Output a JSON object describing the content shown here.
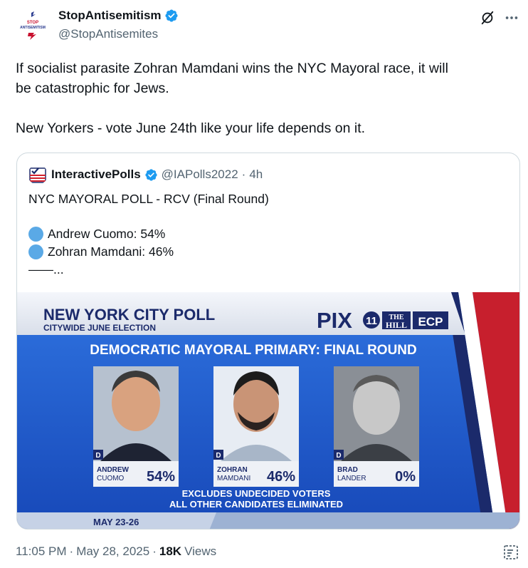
{
  "author": {
    "display_name": "StopAntisemitism",
    "handle": "@StopAntisemites",
    "logo_text_top": "STOP",
    "logo_text_bottom": "ANTISEMITISM"
  },
  "tweet": {
    "line1": "If socialist parasite Zohran Mamdani wins the NYC Mayoral race, it will",
    "line2": "be catastrophic for Jews.",
    "line3": "New Yorkers - vote June 24th like your life depends on it."
  },
  "quote": {
    "display_name": "InteractivePolls",
    "handle": "@IAPolls2022",
    "separator": "·",
    "time": "4h",
    "title": "NYC MAYORAL POLL - RCV (Final Round)",
    "item1": "Andrew Cuomo: 54%",
    "item2": "Zohran Mamdani: 46%",
    "trailer": "——..."
  },
  "poll_image": {
    "headline": "NEW YORK CITY POLL",
    "subhead": "CITYWIDE JUNE ELECTION",
    "brand_pix": "PIX",
    "brand_pix_num": "11",
    "brand_hill_1": "THE",
    "brand_hill_2": "HILL",
    "brand_ecp": "ECP",
    "banner": "DEMOCRATIC MAYORAL PRIMARY: FINAL ROUND",
    "party": "D",
    "candidates": [
      {
        "first": "ANDREW",
        "last": "CUOMO",
        "pct": "54%"
      },
      {
        "first": "ZOHRAN",
        "last": "MAMDANI",
        "pct": "46%"
      },
      {
        "first": "BRAD",
        "last": "LANDER",
        "pct": "0%"
      }
    ],
    "note1": "EXCLUDES UNDECIDED VOTERS",
    "note2": "ALL OTHER CANDIDATES ELIMINATED",
    "dates": "MAY 23-26"
  },
  "footer": {
    "time": "11:05 PM",
    "sep": "·",
    "date": "May 28, 2025",
    "views_num": "18K",
    "views_label": "Views"
  },
  "colors": {
    "verified": "#1d9bf0",
    "poll_blue": "#1d57c9",
    "navy": "#1b2a6b",
    "red": "#d21f2c"
  }
}
